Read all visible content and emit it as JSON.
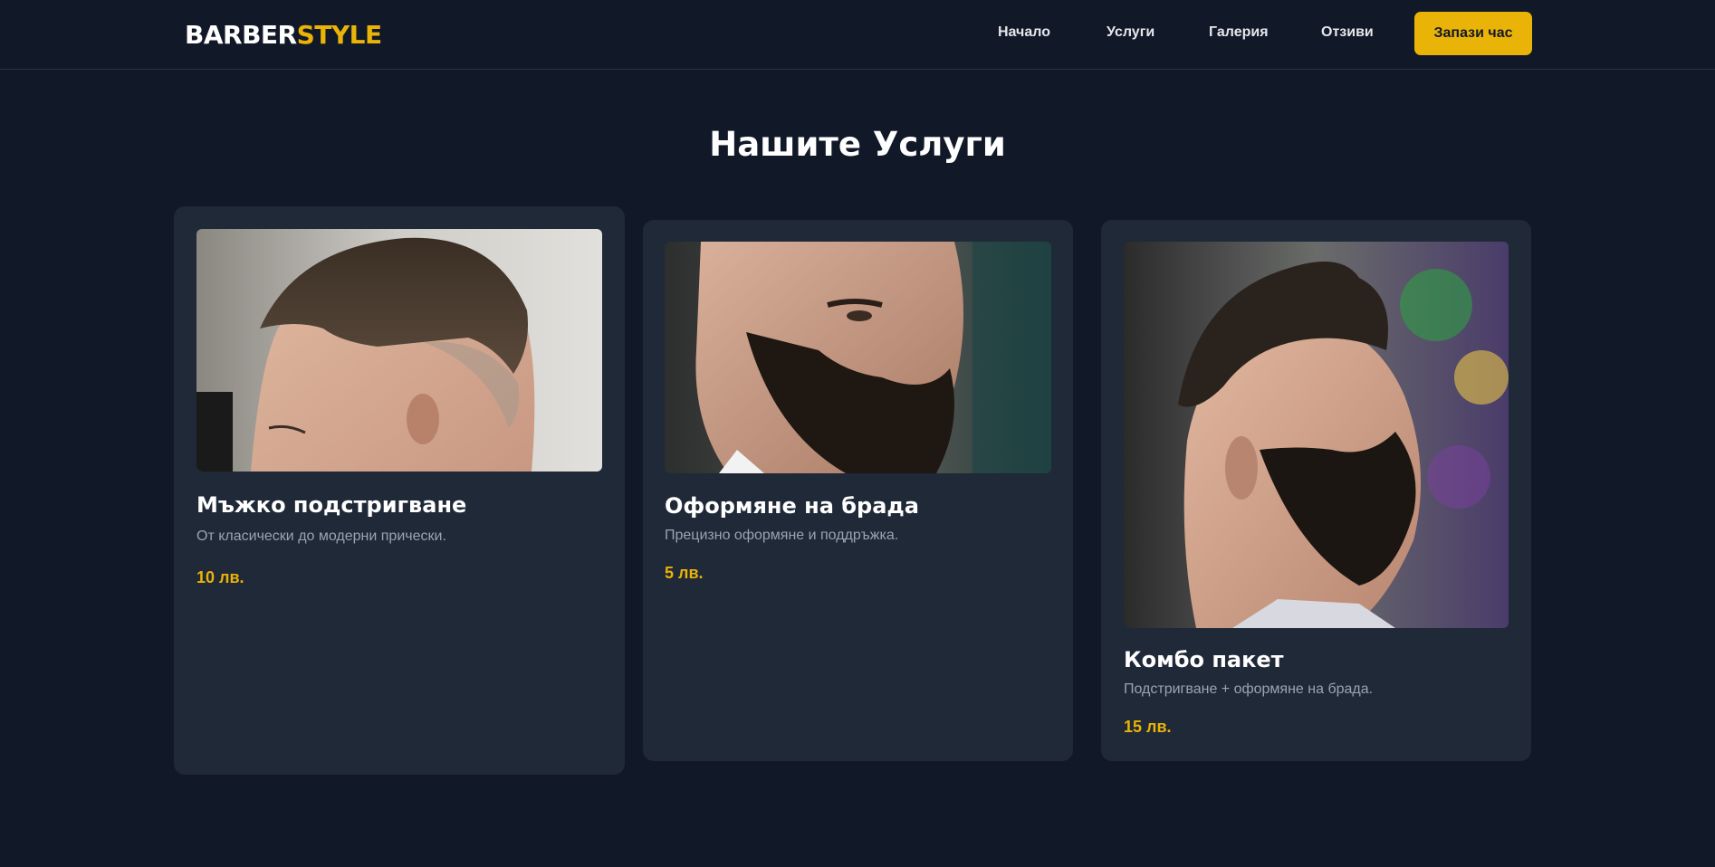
{
  "brand": {
    "part1": "BARBER",
    "part2": "STYLE"
  },
  "nav": {
    "items": [
      {
        "label": "Начало"
      },
      {
        "label": "Услуги"
      },
      {
        "label": "Галерия"
      },
      {
        "label": "Отзиви"
      }
    ],
    "cta_label": "Запази час"
  },
  "services": {
    "title": "Нашите Услуги",
    "cards": [
      {
        "title": "Мъжко подстригване",
        "description": "От класически до модерни прически.",
        "price": "10 лв."
      },
      {
        "title": "Оформяне на брада",
        "description": "Прецизно оформяне и поддръжка.",
        "price": "5 лв."
      },
      {
        "title": "Комбо пакет",
        "description": "Подстригване + оформяне на брада.",
        "price": "15 лв."
      }
    ]
  },
  "colors": {
    "background": "#111827",
    "card": "#1f2937",
    "accent": "#eab308",
    "muted_text": "#9ca3af"
  }
}
